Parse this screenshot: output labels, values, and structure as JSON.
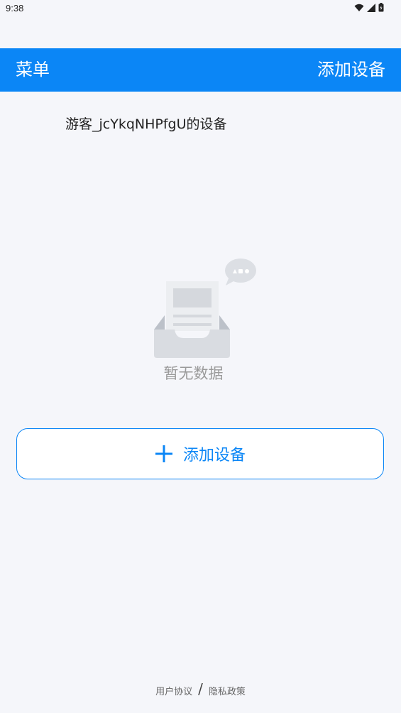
{
  "status_bar": {
    "time": "9:38",
    "icons": [
      "wifi-icon",
      "signal-icon",
      "battery-icon"
    ]
  },
  "app_bar": {
    "menu_label": "菜单",
    "add_label": "添加设备",
    "background": "#0b86f6"
  },
  "device_list": {
    "title": "游客_jcYkqNHPfgU的设备"
  },
  "empty_state": {
    "icon": "empty-inbox-icon",
    "text": "暂无数据"
  },
  "add_button": {
    "icon": "plus-icon",
    "label": "添加设备"
  },
  "footer": {
    "user_agreement": "用户协议",
    "separator": "/",
    "privacy_policy": "隐私政策"
  }
}
